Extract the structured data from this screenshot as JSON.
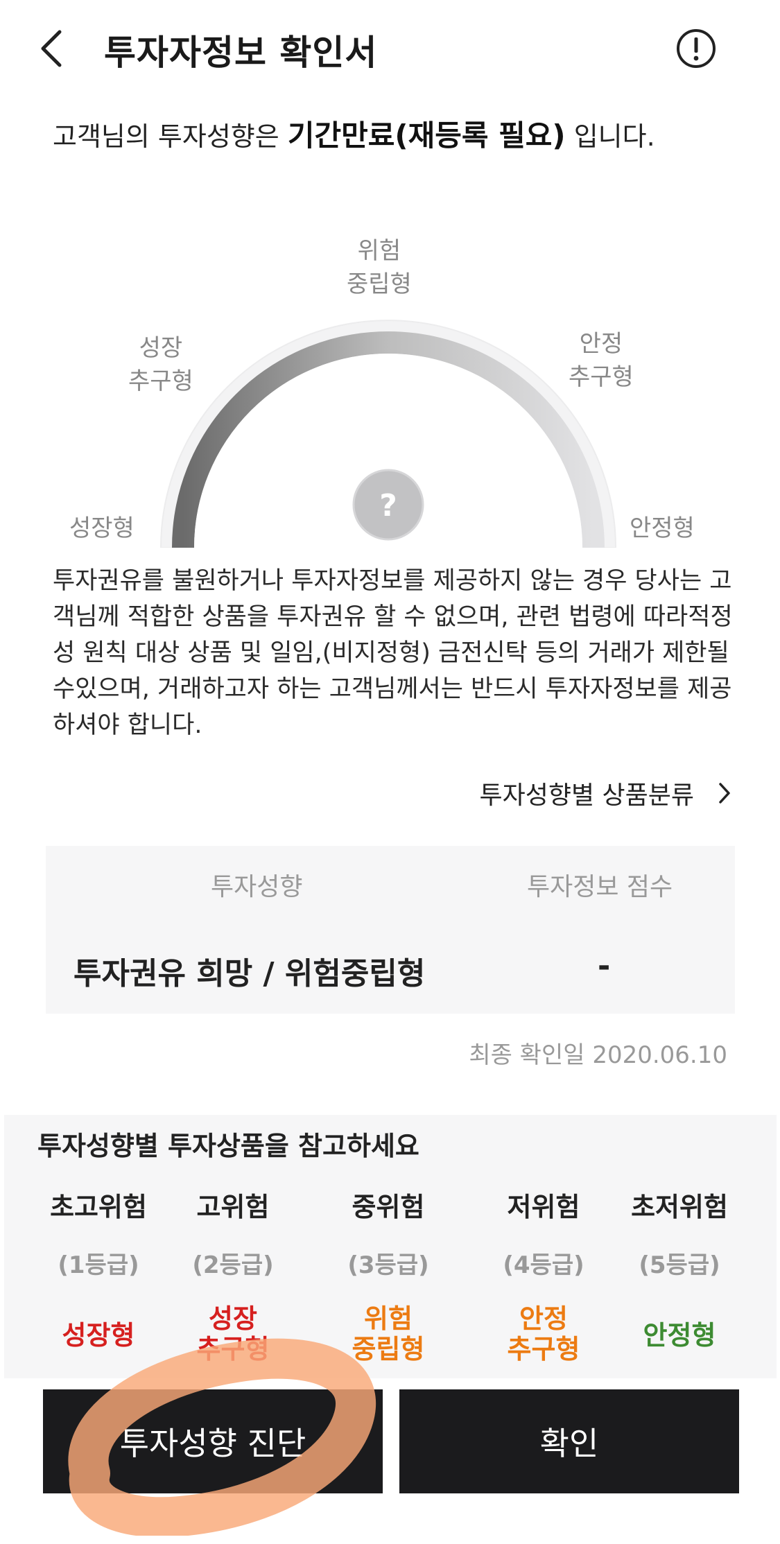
{
  "header": {
    "title": "투자자정보 확인서"
  },
  "profile": {
    "prefix": "고객님의 투자성향은",
    "status": "기간만료(재등록 필요)",
    "suffix": "입니다."
  },
  "gauge": {
    "labels": {
      "growth": [
        "성장형"
      ],
      "growth_pursuit": [
        "성장",
        "추구형"
      ],
      "risk_neutral": [
        "위험",
        "중립형"
      ],
      "stable_pursuit": [
        "안정",
        "추구형"
      ],
      "stable": [
        "안정형"
      ]
    },
    "center_mark": "?"
  },
  "notice": "투자권유를 불원하거나 투자자정보를 제공하지 않는 경우 당사는 고객님께 적합한 상품을 투자권유 할 수 없으며, 관련 법령에 따라적정성 원칙 대상 상품 및 일임,(비지정형) 금전신탁 등의 거래가 제한될 수있으며, 거래하고자 하는 고객님께서는 반드시 투자자정보를 제공하셔야 합니다.",
  "classify_link": {
    "label": "투자성향별 상품분류"
  },
  "profile_table": {
    "headers": {
      "type": "투자성향",
      "score": "투자정보 점수"
    },
    "row": {
      "type": "투자권유 희망 / 위험중립형",
      "score": "-"
    }
  },
  "confirm_date": "최종 확인일 2020.06.10",
  "reference": {
    "title": "투자성향별 투자상품을 참고하세요",
    "grades": [
      {
        "name": "초고위험",
        "level": "(1등급)",
        "type": [
          "성장형"
        ],
        "color": "#d6201f"
      },
      {
        "name": "고위험",
        "level": "(2등급)",
        "type": [
          "성장",
          "추구형"
        ],
        "color": "#d6201f"
      },
      {
        "name": "중위험",
        "level": "(3등급)",
        "type": [
          "위험",
          "중립형"
        ],
        "color": "#ec7b12"
      },
      {
        "name": "저위험",
        "level": "(4등급)",
        "type": [
          "안정",
          "추구형"
        ],
        "color": "#ec7b12"
      },
      {
        "name": "초저위험",
        "level": "(5등급)",
        "type": [
          "안정형"
        ],
        "color": "#3d8b32"
      }
    ]
  },
  "buttons": {
    "diagnose": "투자성향 진단",
    "confirm": "확인"
  },
  "colors": {
    "button_bg": "#1b1b1d",
    "panel_bg": "#f6f6f7",
    "highlight": "#f9a877"
  }
}
